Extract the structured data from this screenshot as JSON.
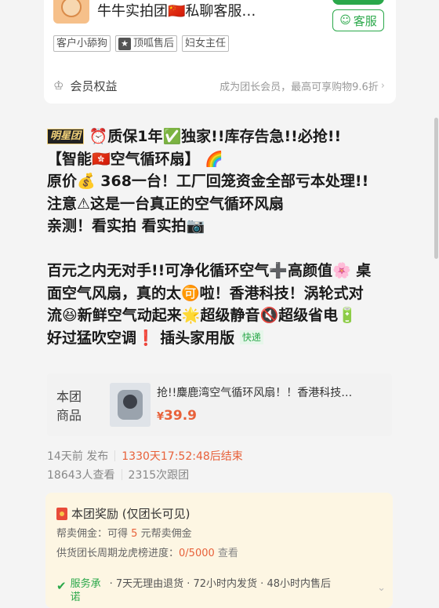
{
  "shop": {
    "name": "牛牛实拍团🇨🇳私聊客服…",
    "kefu_label": "客服",
    "tags": [
      "客户小舔狗",
      "顶呱售后",
      "妇女主任"
    ],
    "member_label": "会员权益",
    "member_hint": "成为团长会员，最高可享购物9.6折"
  },
  "post": {
    "brand": "明星团",
    "lines": [
      "⏰质保1年✅独家!!库存告急!!必抢!!",
      "【智能🇭🇰空气循环扇】 🌈",
      "原价💰 368一台！工厂回笼资金全部亏本处理!!",
      "注意⚠这是一台真正的空气循环风扇",
      "亲测！看实拍 看实拍📷",
      "百元之内无对手!!可净化循环空气➕高颜值🌸 桌",
      "面空气风扇，真的太🉑啦！香港科技！涡轮式对",
      "流😆新鲜空气动起来🌟超级静音🔇超级省电🔋",
      "好过猛吹空调❗ 插头家用版"
    ],
    "express_tag": "快递"
  },
  "product": {
    "label": "本团商品",
    "title": "抢!!麋鹿湾空气循环风扇！！香港科技…",
    "price_symbol": "¥",
    "price": "39.9"
  },
  "meta": {
    "posted": "14天前 发布",
    "countdown": "1330天17:52:48后结束",
    "views": "18643人查看",
    "follows": "2315次跟团"
  },
  "reward": {
    "title": "本团奖励 (仅团长可见)",
    "line1_prefix": "帮卖佣金：可得",
    "line1_num": "5",
    "line1_suffix": "元帮卖佣金",
    "line2_prefix": "供货团长周期龙虎榜进度：",
    "line2_num": "0/5000",
    "line2_link": "查看",
    "service_label": "服务承诺",
    "service_text": "· 7天无理由退货 · 72小时内发货 · 48小时内售后"
  }
}
